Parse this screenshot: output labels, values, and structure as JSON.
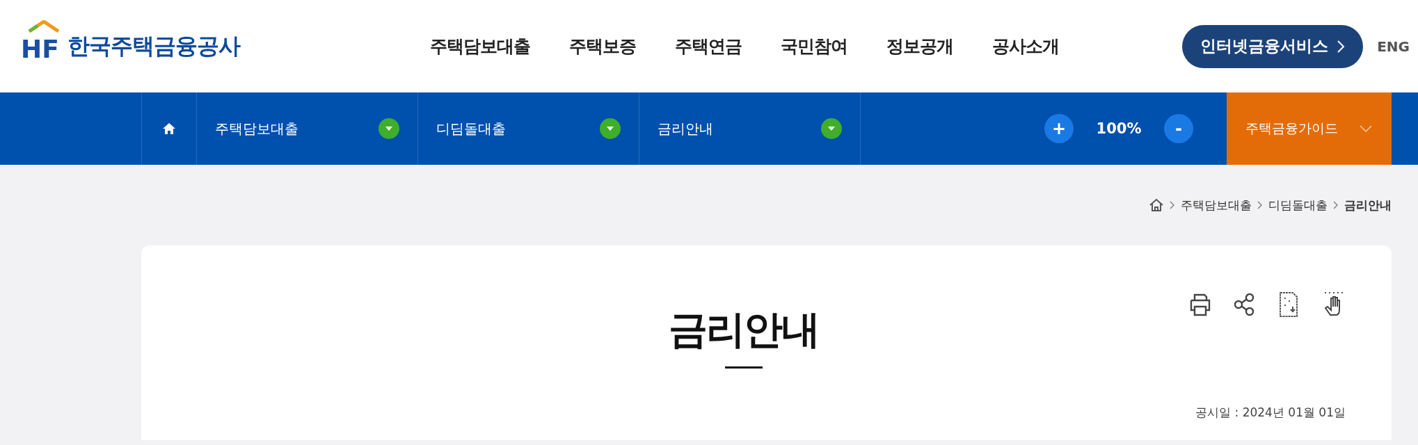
{
  "header": {
    "logo_mark": "HF",
    "logo_text": "한국주택금융공사",
    "nav": [
      "주택담보대출",
      "주택보증",
      "주택연금",
      "국민참여",
      "정보공개",
      "공사소개"
    ],
    "service_button": "인터넷금융서비스",
    "language": "ENG"
  },
  "subnav": {
    "crumbs": [
      {
        "label": "주택담보대출"
      },
      {
        "label": "디딤돌대출"
      },
      {
        "label": "금리안내"
      }
    ],
    "zoom_in": "+",
    "zoom_level": "100%",
    "zoom_out": "-",
    "guide": "주택금융가이드"
  },
  "breadcrumb": [
    "주택담보대출",
    "디딤돌대출",
    "금리안내"
  ],
  "page": {
    "title": "금리안내",
    "notice_date": "공시일 : 2024년 01월 01일"
  }
}
